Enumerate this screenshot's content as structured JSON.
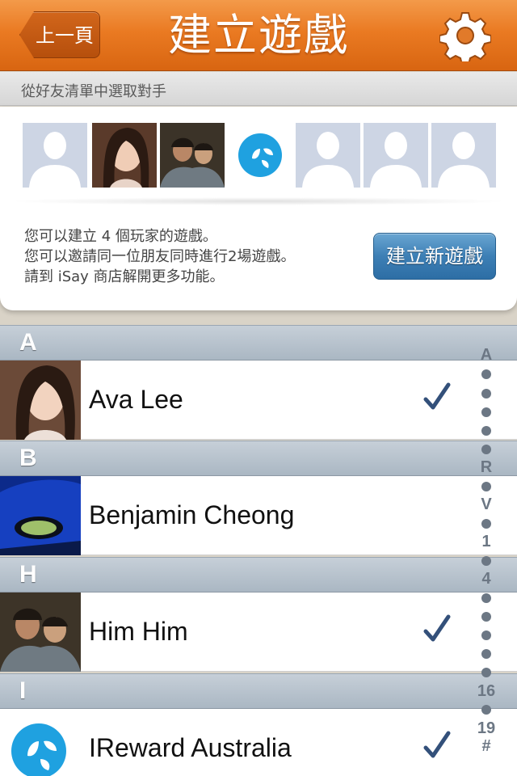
{
  "header": {
    "back_label": "上一頁",
    "title": "建立遊戲"
  },
  "subheader": {
    "label": "從好友清單中選取對手"
  },
  "card": {
    "info_lines": [
      "您可以建立 4 個玩家的遊戲。",
      "您可以邀請同一位朋友同時進行2場遊戲。",
      "請到 iSay 商店解開更多功能。"
    ],
    "create_button": "建立新遊戲",
    "slots": [
      "empty",
      "photo-girl",
      "photo-two-guys",
      "ireward-logo",
      "empty",
      "empty",
      "empty"
    ]
  },
  "list": {
    "sections": [
      {
        "letter": "A",
        "rows": [
          {
            "name": "Ava Lee",
            "checked": true
          }
        ]
      },
      {
        "letter": "B",
        "rows": [
          {
            "name": "Benjamin Cheong",
            "checked": false
          }
        ]
      },
      {
        "letter": "H",
        "rows": [
          {
            "name": "Him Him",
            "checked": true
          }
        ]
      },
      {
        "letter": "I",
        "rows": [
          {
            "name": "IReward Australia",
            "checked": true
          }
        ]
      }
    ]
  },
  "index_bar": [
    "A",
    "•",
    "•",
    "•",
    "•",
    "•",
    "R",
    "•",
    "V",
    "•",
    "1",
    "•",
    "4",
    "•",
    "•",
    "•",
    "•",
    "•",
    "16",
    "•",
    "19",
    "#"
  ],
  "colors": {
    "header_orange": "#ea7a22",
    "button_blue": "#3d7fb5",
    "checkmark": "#33507a",
    "section_header": "#aab7c3"
  }
}
